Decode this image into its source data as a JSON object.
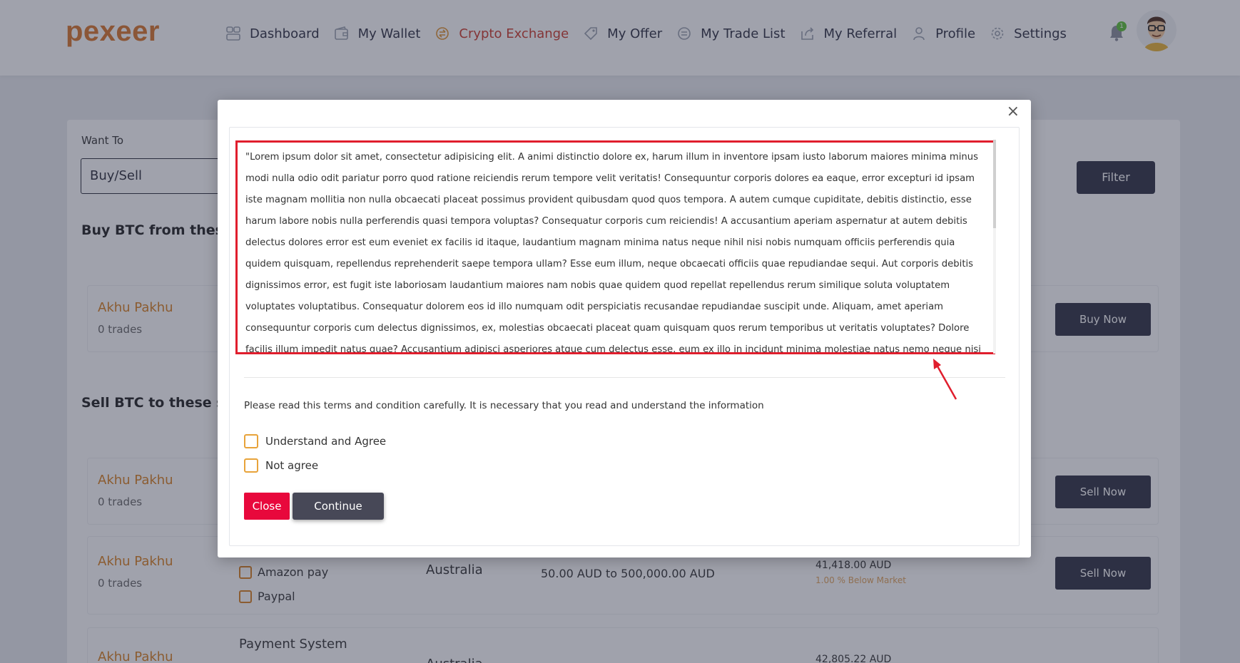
{
  "brand": {
    "logo_text": "pexeer",
    "accent": "#d9762b"
  },
  "nav": {
    "items": [
      {
        "label": "Dashboard",
        "icon": "dashboard-icon",
        "active": false
      },
      {
        "label": "My Wallet",
        "icon": "wallet-icon",
        "active": false
      },
      {
        "label": "Crypto Exchange",
        "icon": "exchange-icon",
        "active": true
      },
      {
        "label": "My Offer",
        "icon": "offer-icon",
        "active": false
      },
      {
        "label": "My Trade List",
        "icon": "trade-list-icon",
        "active": false
      },
      {
        "label": "My Referral",
        "icon": "referral-icon",
        "active": false
      },
      {
        "label": "Profile",
        "icon": "profile-icon",
        "active": false
      },
      {
        "label": "Settings",
        "icon": "gear-icon",
        "active": false
      }
    ],
    "notification_count": "1"
  },
  "filters": {
    "want_to_label": "Want To",
    "want_to_value": "Buy/Sell",
    "filter_button": "Filter"
  },
  "sections": {
    "buy_title": "Buy BTC from these s",
    "sell_title": "Sell BTC to these sel"
  },
  "rows": [
    {
      "name": "Akhu Pakhu",
      "trades": "0 trades",
      "button": "Buy Now"
    },
    {
      "name": "Akhu Pakhu",
      "trades": "0 trades",
      "button": "Sell Now"
    },
    {
      "name": "Akhu Pakhu",
      "trades": "0 trades",
      "button": "Sell Now",
      "payment_methods": [
        "Amazon pay",
        "Paypal"
      ],
      "country": "Australia",
      "limits": "50.00 AUD to 500,000.00 AUD",
      "price": "41,418.00 AUD",
      "price_note": "1.00 % Below Market"
    },
    {
      "name": "Akhu Pakhu",
      "payment_header": "Payment System",
      "country": "Australia",
      "price": "42,805.22 AUD"
    }
  ],
  "modal": {
    "close_x": "×",
    "terms_text": "\"Lorem ipsum dolor sit amet, consectetur adipisicing elit. A animi distinctio dolore ex, harum illum in inventore ipsam iusto laborum maiores minima minus modi nulla odio odit pariatur porro quod ratione reiciendis rerum tempore velit veritatis! Consequuntur corporis dolores ea eaque, error excepturi id ipsam iste magnam mollitia non nulla obcaecati placeat possimus provident quibusdam quod quos tempora. A autem cumque cupiditate, debitis distinctio, esse harum labore nobis nulla perferendis quasi tempora voluptas? Consequatur corporis cum reiciendis! A accusantium aperiam aspernatur at autem debitis delectus dolores error est eum eveniet ex facilis id itaque, laudantium magnam minima natus neque nihil nisi nobis numquam officiis perferendis quia quidem quisquam, repellendus reprehenderit saepe tempora ullam? Esse eum illum, neque obcaecati officiis quae repudiandae sequi. Aut corporis debitis dignissimos error, est fugit iste laboriosam laudantium maiores nam nobis quae quidem quod repellat repellendus rerum similique soluta voluptatem voluptates voluptatibus. Consequatur dolorem eos id illo numquam odit perspiciatis recusandae repudiandae suscipit unde. Aliquam, amet aperiam consequuntur corporis cum delectus dignissimos, ex, molestias obcaecati placeat quam quisquam quos rerum temporibus ut veritatis voluptates? Dolore facilis illum impedit natus quae? Accusantium adipisci asperiores atque cum delectus esse, eum ex illo in incidunt minima molestiae natus nemo neque nisi odio officiis possimus provident quae quaerat quas",
    "notice": "Please read this terms and condition carefully. It is necessary that you read and understand the information",
    "agree_label": "Understand and Agree",
    "disagree_label": "Not agree",
    "close_button": "Close",
    "continue_button": "Continue"
  }
}
